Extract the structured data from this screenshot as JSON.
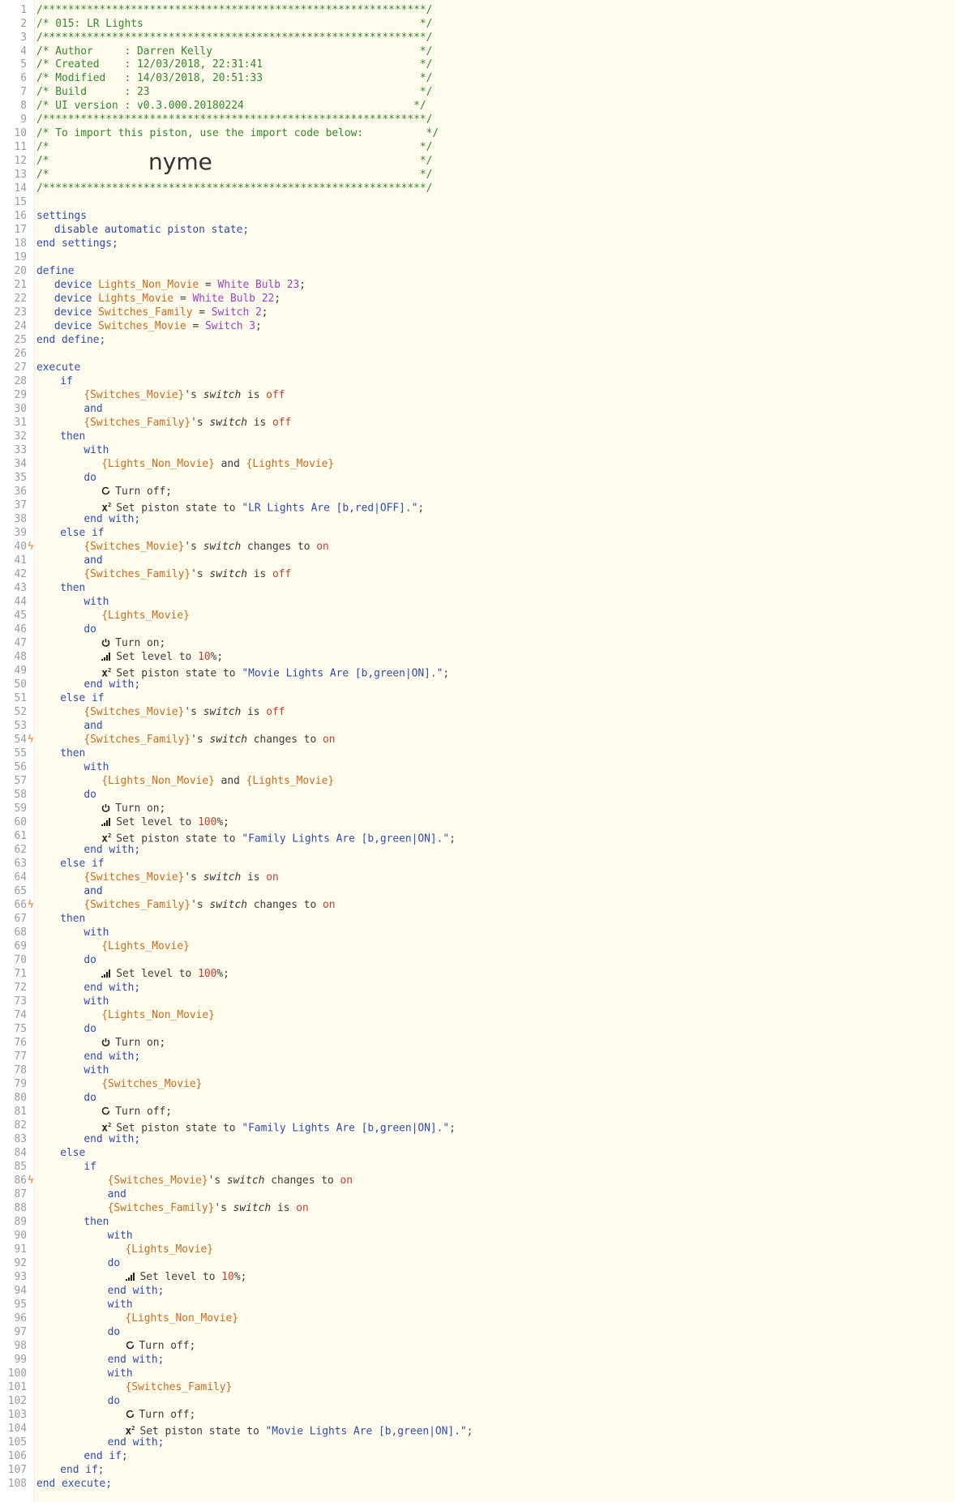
{
  "header": {
    "border": "/*************************************************************/",
    "title": "/* 015: LR Lights                                            */",
    "author": "/* Author     : Darren Kelly                                 */",
    "created": "/* Created    : 12/03/2018, 22:31:41                         */",
    "modified": "/* Modified   : 14/03/2018, 20:51:33                         */",
    "build": "/* Build      : 23                                           */",
    "ui_version": "/* UI version : v0.3.000.20180224                           */",
    "import_note": "/* To import this piston, use the import code below:          */",
    "blank": "/*                                                           */",
    "blank_b": "/*                                                           */",
    "import_code": "nyme"
  },
  "kw": {
    "settings": "settings",
    "end_settings": "end settings;",
    "define": "define",
    "end_define": "end define;",
    "execute": "execute",
    "end_execute": "end execute;",
    "if": "if",
    "else_if": "else if",
    "else": "else",
    "and": "and",
    "then": "then",
    "with": "with",
    "do": "do",
    "end_with": "end with;",
    "end_if": "end if;",
    "device": "device"
  },
  "settings_line": "disable automatic piston state;",
  "devices": [
    {
      "var": "Lights_Non_Movie",
      "value": "White Bulb 23"
    },
    {
      "var": "Lights_Movie",
      "value": "White Bulb 22"
    },
    {
      "var": "Switches_Family",
      "value": "Switch 2"
    },
    {
      "var": "Switches_Movie",
      "value": "Switch 3"
    }
  ],
  "lines": {
    "l29": {
      "dev": "{Switches_Movie}",
      "prop": "switch",
      "op": "is",
      "val": "off"
    },
    "l31": {
      "dev": "{Switches_Family}",
      "prop": "switch",
      "op": "is",
      "val": "off"
    },
    "l34": {
      "a": "{Lights_Non_Movie}",
      "b": "{Lights_Movie}"
    },
    "l36": {
      "cmd": "Turn off;"
    },
    "l37": {
      "cmd": "Set piston state to",
      "str": "\"LR Lights Are [b,red|OFF].\""
    },
    "l40": {
      "dev": "{Switches_Movie}",
      "prop": "switch",
      "op": "changes to",
      "val": "on"
    },
    "l42": {
      "dev": "{Switches_Family}",
      "prop": "switch",
      "op": "is",
      "val": "off"
    },
    "l45": {
      "a": "{Lights_Movie}"
    },
    "l47": {
      "cmd": "Turn on;"
    },
    "l48": {
      "cmd": "Set level to",
      "num": "10",
      "suffix": "%;"
    },
    "l49": {
      "cmd": "Set piston state to",
      "str": "\"Movie Lights Are [b,green|ON].\""
    },
    "l52": {
      "dev": "{Switches_Movie}",
      "prop": "switch",
      "op": "is",
      "val": "off"
    },
    "l54": {
      "dev": "{Switches_Family}",
      "prop": "switch",
      "op": "changes to",
      "val": "on"
    },
    "l57": {
      "a": "{Lights_Non_Movie}",
      "b": "{Lights_Movie}"
    },
    "l59": {
      "cmd": "Turn on;"
    },
    "l60": {
      "cmd": "Set level to",
      "num": "100",
      "suffix": "%;"
    },
    "l61": {
      "cmd": "Set piston state to",
      "str": "\"Family Lights Are [b,green|ON].\""
    },
    "l64": {
      "dev": "{Switches_Movie}",
      "prop": "switch",
      "op": "is",
      "val": "on"
    },
    "l66": {
      "dev": "{Switches_Family}",
      "prop": "switch",
      "op": "changes to",
      "val": "on"
    },
    "l69": {
      "a": "{Lights_Movie}"
    },
    "l71": {
      "cmd": "Set level to",
      "num": "100",
      "suffix": "%;"
    },
    "l74": {
      "a": "{Lights_Non_Movie}"
    },
    "l76": {
      "cmd": "Turn on;"
    },
    "l79": {
      "a": "{Switches_Movie}"
    },
    "l81": {
      "cmd": "Turn off;"
    },
    "l82": {
      "cmd": "Set piston state to",
      "str": "\"Family Lights Are [b,green|ON].\""
    },
    "l86": {
      "dev": "{Switches_Movie}",
      "prop": "switch",
      "op": "changes to",
      "val": "on"
    },
    "l88": {
      "dev": "{Switches_Family}",
      "prop": "switch",
      "op": "is",
      "val": "on"
    },
    "l91": {
      "a": "{Lights_Movie}"
    },
    "l93": {
      "cmd": "Set level to",
      "num": "10",
      "suffix": "%;"
    },
    "l96": {
      "a": "{Lights_Non_Movie}"
    },
    "l98": {
      "cmd": "Turn off;"
    },
    "l101": {
      "a": "{Switches_Family}"
    },
    "l103": {
      "cmd": "Turn off;"
    },
    "l104": {
      "cmd": "Set piston state to",
      "str": "\"Movie Lights Are [b,green|ON].\""
    }
  },
  "possessive": "'s",
  "eq": "=",
  "semi": ";",
  "icons": {
    "power_off": "power-off-icon",
    "power_on": "power-on-icon",
    "level": "level-bars-icon",
    "state": "x2-variable-icon"
  },
  "colors": {
    "comment": "#2f8a28",
    "keyword": "#2b4bb8",
    "variable": "#cf6a1a",
    "value": "#9d3fc4",
    "operator": "#cf3b2a",
    "trigger_bolt": "#f07a1c",
    "background": "#fffcee"
  }
}
